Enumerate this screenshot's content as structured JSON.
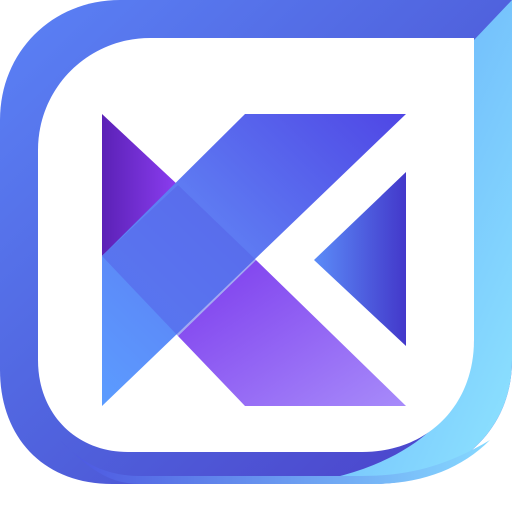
{
  "logo": {
    "icon": "kx-app-icon",
    "colors": {
      "frame_start": "#5B82F6",
      "frame_mid": "#4F5FDB",
      "frame_dark": "#4B3FC8",
      "frame_light": "#8EE4FF",
      "mark_purple_dark": "#5B21B6",
      "mark_purple": "#7C3AED",
      "mark_violet": "#A07BFF",
      "mark_blue": "#5B9CFF",
      "mark_indigo": "#4338CA",
      "background": "#FFFFFF"
    }
  }
}
